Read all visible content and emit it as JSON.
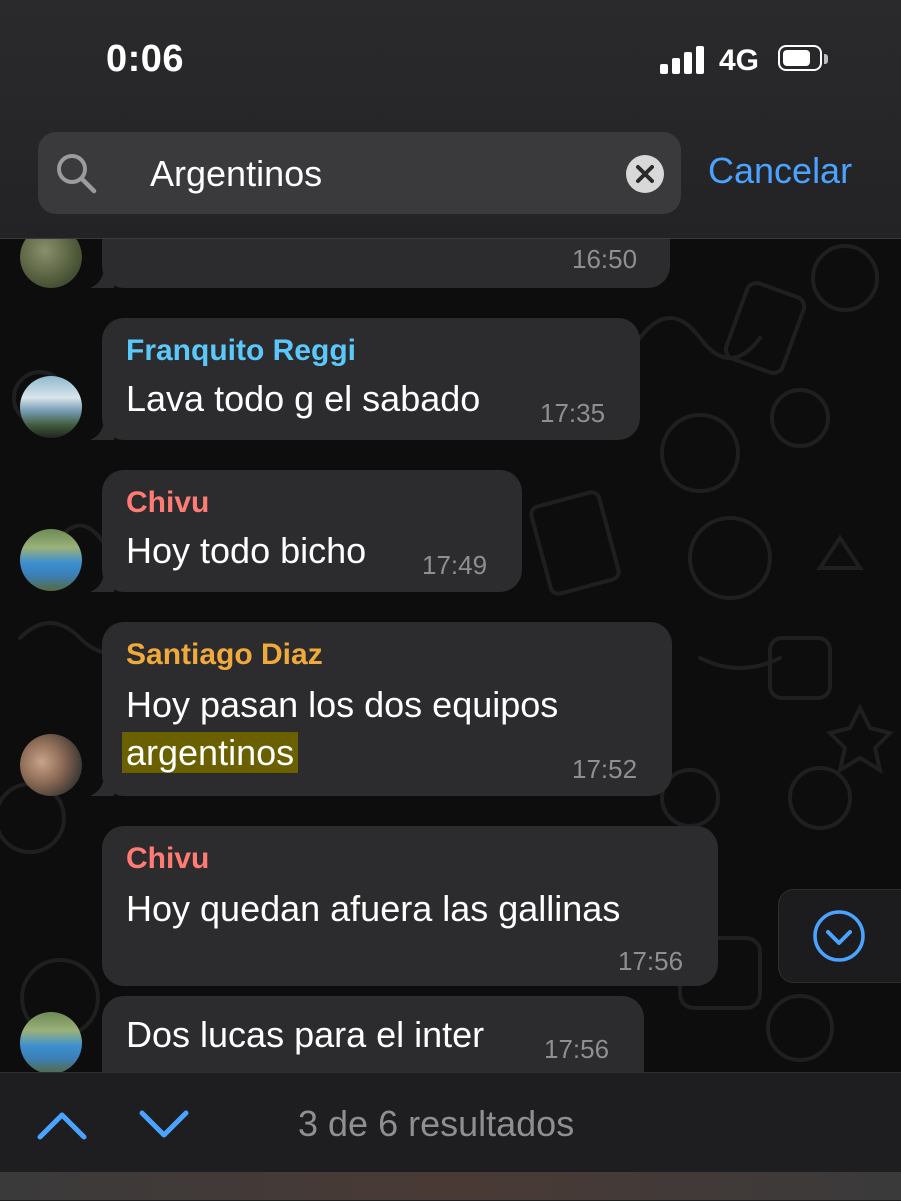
{
  "status_bar": {
    "time": "0:06",
    "network": "4G",
    "battery_level": 0.8
  },
  "search": {
    "query": "Argentinos",
    "cancel_label": "Cancelar"
  },
  "messages": [
    {
      "sender": "",
      "text": "",
      "time": "16:50"
    },
    {
      "sender": "Franquito Reggi",
      "sender_color": "#5ac8fa",
      "text": "Lava todo g el sabado",
      "time": "17:35"
    },
    {
      "sender": "Chivu",
      "sender_color": "#ff7b73",
      "text": "Hoy todo bicho",
      "time": "17:49"
    },
    {
      "sender": "Santiago Diaz",
      "sender_color": "#f0a93b",
      "text_line1": "Hoy pasan los dos equipos",
      "text_highlight": "argentinos",
      "time": "17:52"
    },
    {
      "sender": "Chivu",
      "sender_color": "#ff7b73",
      "text": "Hoy quedan afuera las gallinas",
      "time": "17:56"
    },
    {
      "sender": "",
      "text": "Dos lucas para el inter",
      "time": "17:56"
    }
  ],
  "results": {
    "summary": "3 de 6 resultados"
  },
  "colors": {
    "accent": "#4aa3ff",
    "bubble": "#2c2c2e",
    "highlight": "#6b6000"
  },
  "icons": [
    "search-icon",
    "clear-icon",
    "chevron-up-icon",
    "chevron-down-icon",
    "scroll-down-icon",
    "signal-icon",
    "battery-icon"
  ]
}
